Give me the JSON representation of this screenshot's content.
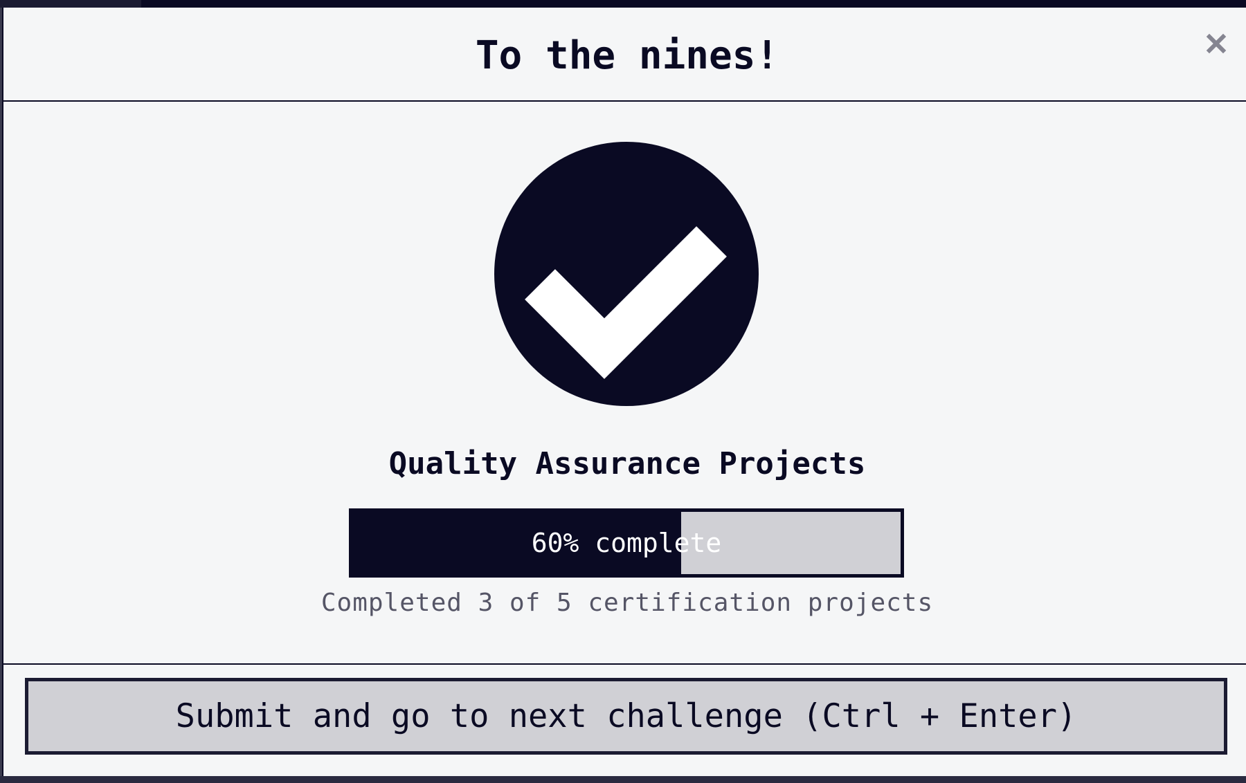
{
  "modal": {
    "title": "To the nines!",
    "close_icon": "close-icon"
  },
  "success": {
    "icon": "checkmark-circle-icon"
  },
  "certification": {
    "title": "Quality Assurance Projects",
    "progress_percent": 60,
    "progress_label": "60% complete",
    "detail": "Completed 3 of 5 certification projects"
  },
  "footer": {
    "submit_label": "Submit and go to next challenge (Ctrl + Enter)"
  },
  "colors": {
    "dark": "#0a0a23",
    "light": "#f5f6f7",
    "gray": "#d0d0d5",
    "close": "#858591"
  }
}
